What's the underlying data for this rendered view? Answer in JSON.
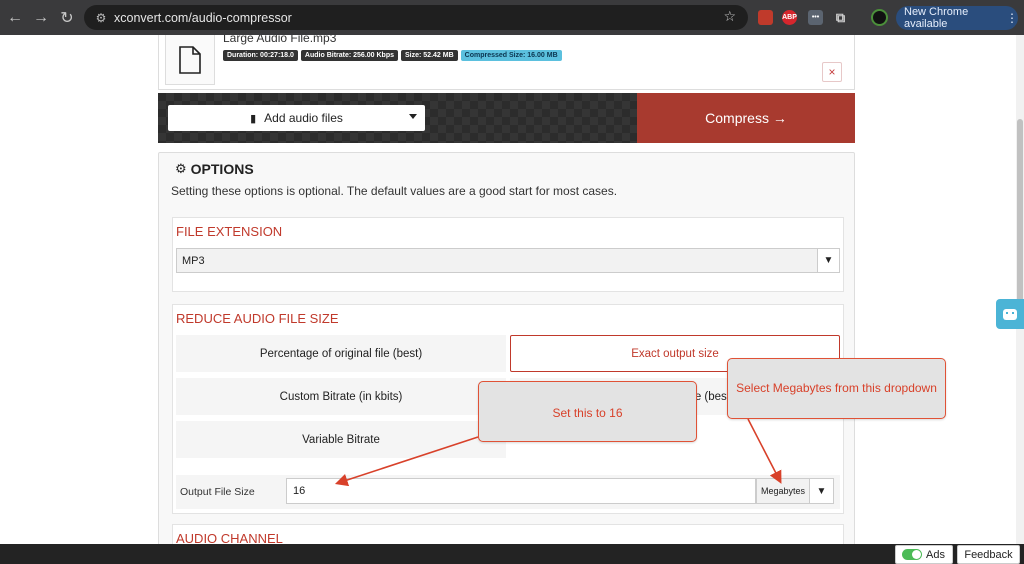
{
  "browser": {
    "url": "xconvert.com/audio-compressor",
    "update_label": "New Chrome available",
    "ext_abp": "ABP",
    "ext_dots": "•••"
  },
  "file": {
    "name": "Large Audio File.mp3",
    "duration": "Duration: 00:27:18.0",
    "bitrate": "Audio Bitrate: 256.00 Kbps",
    "size": "Size: 52.42 MB",
    "compressed": "Compressed Size: 16.00 MB",
    "remove_icon": "×"
  },
  "actions": {
    "add_files": "Add audio files",
    "compress": "Compress →"
  },
  "options": {
    "title": "OPTIONS",
    "description": "Setting these options is optional. The default values are a good start for most cases.",
    "file_extension": {
      "title": "FILE EXTENSION",
      "selected": "MP3"
    },
    "reduce": {
      "title": "REDUCE AUDIO FILE SIZE",
      "methods": [
        "Percentage of original file (best)",
        "Exact output size",
        "Custom Bitrate (in kbits)",
        "e (best",
        "Variable Bitrate"
      ],
      "output_label": "Output File Size",
      "output_value": "16",
      "unit": "Megabytes"
    },
    "audio_channel": {
      "title": "AUDIO CHANNEL"
    }
  },
  "annotations": {
    "set_value": "Set this to 16",
    "select_unit": "Select Megabytes from this dropdown"
  },
  "footer": {
    "ads_label": "Ads",
    "feedback_label": "Feedback"
  },
  "colors": {
    "accent_red": "#c0392b",
    "compress_bg": "#a83a2f",
    "callout_border": "#e05236",
    "badge_accent": "#5bc0de"
  }
}
